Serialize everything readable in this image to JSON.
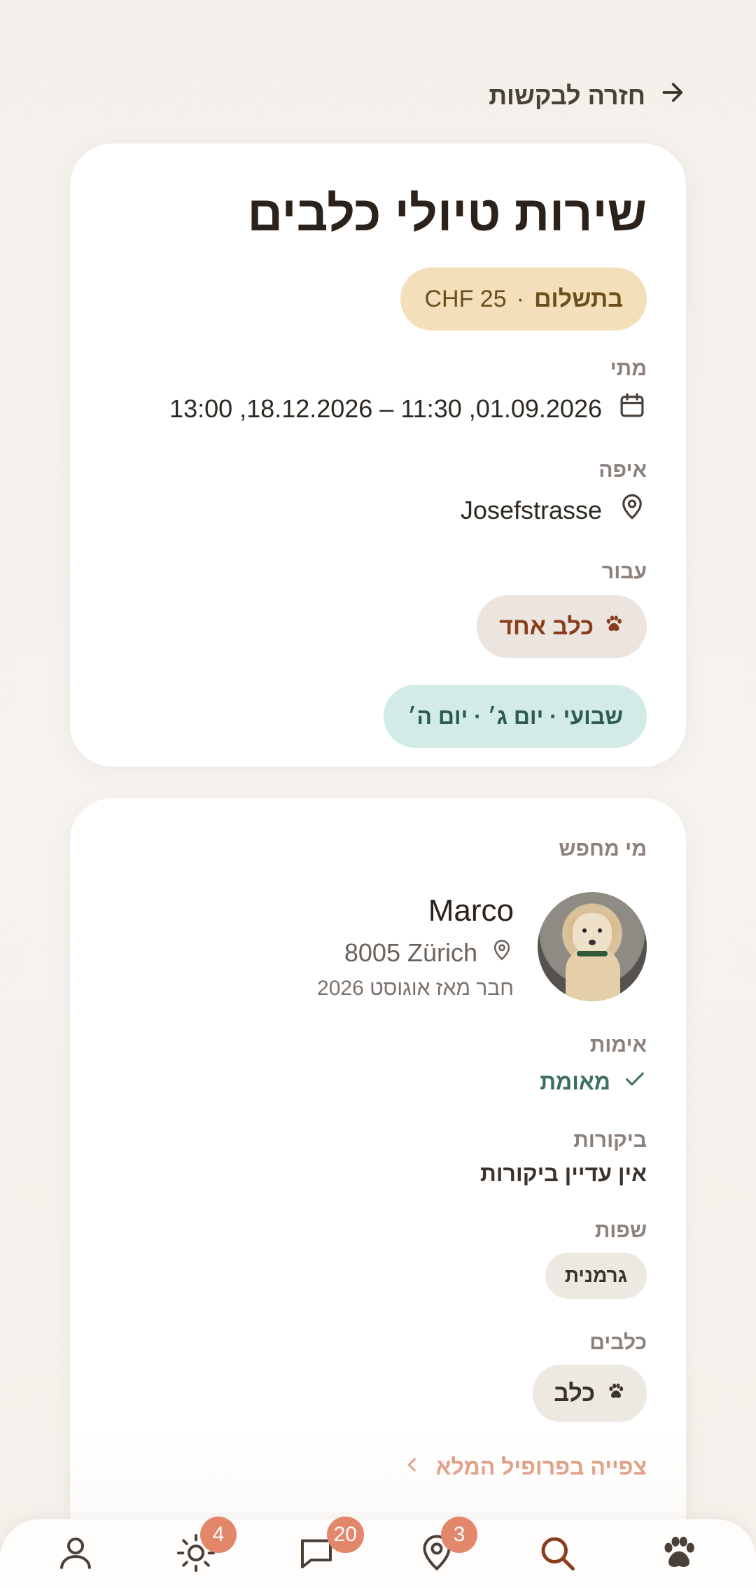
{
  "back": {
    "label": "חזרה לבקשות",
    "icon": "arrow-right-icon"
  },
  "request": {
    "title": "שירות טיולי כלבים",
    "payment": {
      "prefix": "בתשלום",
      "separator": "·",
      "price": "CHF 25"
    },
    "when": {
      "label": "מתי",
      "value": "01.09.2026, 11:30 – 18.12.2026, 13:00"
    },
    "where": {
      "label": "איפה",
      "value": "Josefstrasse"
    },
    "for": {
      "label": "עבור",
      "value": "כלב אחד"
    },
    "schedule": "שבועי · יום ג׳ · יום ה׳"
  },
  "requester": {
    "label": "מי מחפש",
    "name": "Marco",
    "location": "8005 Zürich",
    "member_since": "חבר מאז אוגוסט 2026",
    "verification": {
      "label": "אימות",
      "value": "מאומת"
    },
    "reviews": {
      "label": "ביקורות",
      "value": "אין עדיין ביקורות"
    },
    "languages": {
      "label": "שפות",
      "items": [
        "גרמנית"
      ]
    },
    "dogs": {
      "label": "כלבים",
      "items": [
        "כלב"
      ]
    },
    "view_profile": "צפייה בפרופיל המלא"
  },
  "nav": {
    "items": [
      {
        "name": "profile",
        "icon": "user-icon"
      },
      {
        "name": "sun",
        "icon": "sun-icon",
        "badge": "4"
      },
      {
        "name": "messages",
        "icon": "chat-icon",
        "badge": "20"
      },
      {
        "name": "nearby",
        "icon": "map-pin-icon",
        "badge": "3"
      },
      {
        "name": "search",
        "icon": "search-icon"
      },
      {
        "name": "home",
        "icon": "paw-icon"
      }
    ]
  },
  "colors": {
    "accent": "#d98a68",
    "badge": "#e3876a",
    "payment_pill": "#f3dfb9",
    "schedule_pill": "#d3ebe6",
    "verified": "#3e6f63",
    "nav_active": "#8a3d1c"
  }
}
